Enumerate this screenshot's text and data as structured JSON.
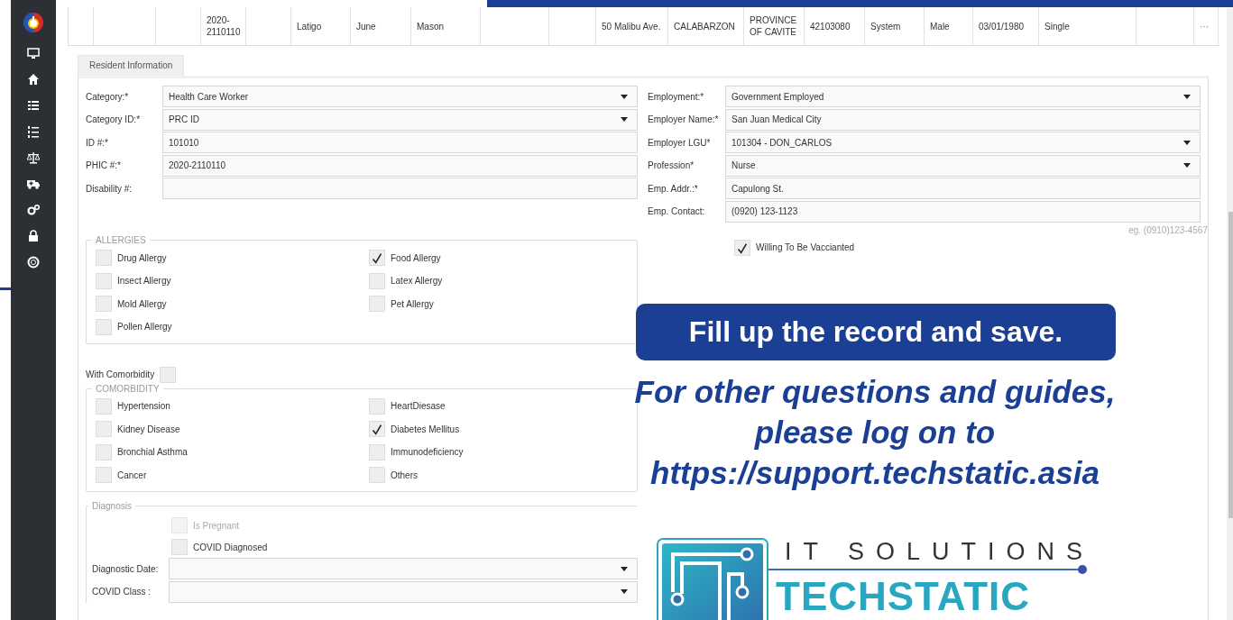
{
  "table": {
    "rows": [
      {
        "cells": [
          "2020-2110110",
          "Latigo",
          "June",
          "Mason",
          "50 Malibu Ave.",
          "CALABARZON",
          "PROVINCE OF CAVITE",
          "42103080",
          "System",
          "Male",
          "03/01/1980",
          "Single",
          "···"
        ]
      }
    ]
  },
  "tabs": [
    {
      "label": "Resident Information",
      "selected": true
    }
  ],
  "form": {
    "left_fields": [
      {
        "label": "Category:*",
        "kind": "select",
        "value": "Health Care Worker"
      },
      {
        "label": "Category ID:*",
        "kind": "select",
        "value": "PRC ID"
      },
      {
        "label": "ID #:*",
        "kind": "text",
        "value": "101010"
      },
      {
        "label": "PHIC #:*",
        "kind": "text",
        "value": "2020-2110110"
      },
      {
        "label": "Disability #:",
        "kind": "text"
      }
    ],
    "right_fields": [
      {
        "label": "Employment:*",
        "kind": "select",
        "value": "Government Employed"
      },
      {
        "label": "Employer Name:*",
        "kind": "text",
        "value": "San Juan Medical City"
      },
      {
        "label": "Employer LGU*",
        "kind": "select",
        "value": "101304 - DON_CARLOS"
      },
      {
        "label": "Profession*",
        "kind": "select",
        "value": "Nurse"
      },
      {
        "label": "Emp. Addr.:*",
        "kind": "text",
        "value": "Capulong St."
      },
      {
        "label": "Emp. Contact:",
        "kind": "text",
        "value": "(0920) 123-1123"
      }
    ],
    "contact_hint": "eg. (0910)123-4567",
    "willing": {
      "label": "Willing To Be Vaccianted",
      "checked": true
    },
    "allergies": {
      "title": "ALLERGIES",
      "items": [
        {
          "label": "Drug Allergy",
          "checked": false
        },
        {
          "label": "Food Allergy",
          "checked": true
        },
        {
          "label": "Insect Allergy",
          "checked": false
        },
        {
          "label": "Latex Allergy",
          "checked": false
        },
        {
          "label": "Mold Allergy",
          "checked": false
        },
        {
          "label": "Pet Allergy",
          "checked": false
        },
        {
          "label": "Pollen Allergy",
          "checked": false
        }
      ]
    },
    "with_comorbidity": {
      "label": "With Comorbidity",
      "checked": false
    },
    "comorbidity": {
      "title": "COMORBIDITY",
      "items": [
        {
          "label": "Hypertension",
          "checked": false
        },
        {
          "label": "HeartDiesase",
          "checked": false
        },
        {
          "label": "Kidney Disease",
          "checked": false
        },
        {
          "label": "Diabetes Mellitus",
          "checked": true
        },
        {
          "label": "Bronchial Asthma",
          "checked": false
        },
        {
          "label": "Immunodeficiency",
          "checked": false
        },
        {
          "label": "Cancer",
          "checked": false
        },
        {
          "label": "Others",
          "checked": false
        }
      ]
    },
    "diagnosis": {
      "title": "Diagnosis",
      "checks": [
        {
          "label": "Is Pregnant",
          "checked": false,
          "disabled": true
        },
        {
          "label": "COVID Diagnosed",
          "checked": false,
          "disabled": false
        }
      ],
      "fields": [
        {
          "label": "Diagnostic Date:",
          "kind": "select"
        },
        {
          "label": "COVID Class :",
          "kind": "select"
        }
      ]
    }
  },
  "overlay": {
    "callout": "Fill up the record and save.",
    "support_lines": [
      "For other questions and guides,",
      "please log on to",
      "https://support.techstatic.asia"
    ],
    "logo": {
      "tagline": "IT SOLUTIONS",
      "wordmark": "TECHSTATIC"
    }
  }
}
